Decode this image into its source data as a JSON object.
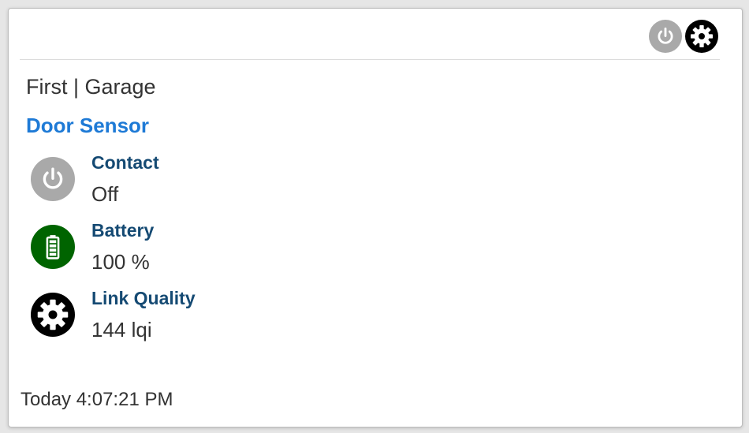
{
  "header": {
    "icons": [
      "power-icon",
      "gear-icon"
    ]
  },
  "location": "First | Garage",
  "device": {
    "name": "Door Sensor"
  },
  "attributes": [
    {
      "label": "Contact",
      "value": "Off",
      "icon": "power-icon",
      "icon_bg": "#a9a9a9"
    },
    {
      "label": "Battery",
      "value": "100 %",
      "icon": "battery-icon",
      "icon_bg": "#006400"
    },
    {
      "label": "Link Quality",
      "value": "144 lqi",
      "icon": "gear-icon",
      "icon_bg": "#000000"
    }
  ],
  "timestamp": "Today 4:07:21 PM",
  "colors": {
    "device_link": "#1e7ad6",
    "attr_label": "#154a73",
    "power_bg": "#a9a9a9",
    "battery_bg": "#006400",
    "gear_bg": "#000000"
  }
}
